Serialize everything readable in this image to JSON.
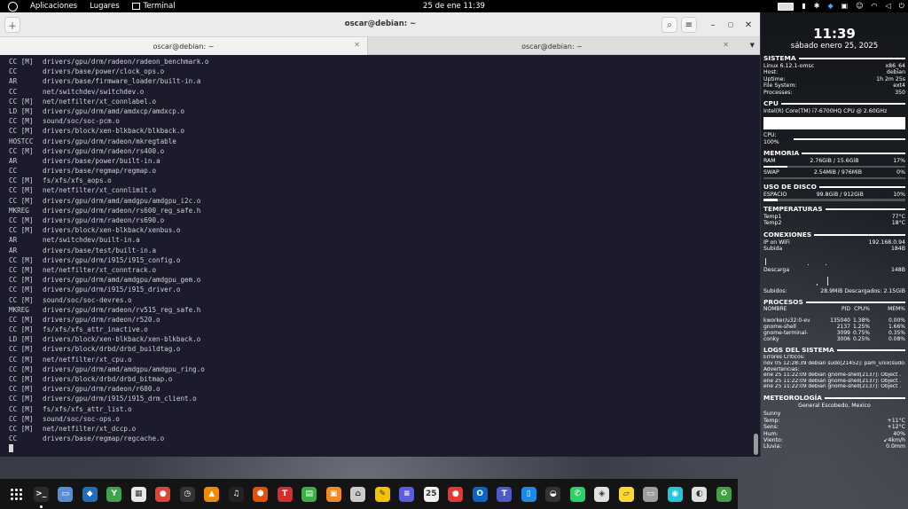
{
  "topbar": {
    "applications": "Aplicaciones",
    "places": "Lugares",
    "terminal_app": "Terminal",
    "clock": "25 de ene  11:39"
  },
  "window": {
    "title": "oscar@debian: ~",
    "tabs": [
      {
        "label": "oscar@debian: ~",
        "active": true
      },
      {
        "label": "oscar@debian: ~",
        "active": false
      }
    ]
  },
  "terminal": {
    "lines": [
      [
        "CC [M]",
        "drivers/gpu/drm/radeon/radeon_benchmark.o"
      ],
      [
        "CC",
        "drivers/base/power/clock_ops.o"
      ],
      [
        "AR",
        "drivers/base/firmware_loader/built-in.a"
      ],
      [
        "CC",
        "net/switchdev/switchdev.o"
      ],
      [
        "CC [M]",
        "net/netfilter/xt_connlabel.o"
      ],
      [
        "LD [M]",
        "drivers/gpu/drm/amd/amdxcp/amdxcp.o"
      ],
      [
        "CC [M]",
        "sound/soc/soc-pcm.o"
      ],
      [
        "CC [M]",
        "drivers/block/xen-blkback/blkback.o"
      ],
      [
        "HOSTCC",
        "drivers/gpu/drm/radeon/mkregtable"
      ],
      [
        "CC [M]",
        "drivers/gpu/drm/radeon/rs400.o"
      ],
      [
        "AR",
        "drivers/base/power/built-in.a"
      ],
      [
        "CC",
        "drivers/base/regmap/regmap.o"
      ],
      [
        "CC [M]",
        "fs/xfs/xfs_aops.o"
      ],
      [
        "CC [M]",
        "net/netfilter/xt_connlimit.o"
      ],
      [
        "CC [M]",
        "drivers/gpu/drm/amd/amdgpu/amdgpu_i2c.o"
      ],
      [
        "MKREG",
        "drivers/gpu/drm/radeon/rs600_reg_safe.h"
      ],
      [
        "CC [M]",
        "drivers/gpu/drm/radeon/rs690.o"
      ],
      [
        "CC [M]",
        "drivers/block/xen-blkback/xenbus.o"
      ],
      [
        "AR",
        "net/switchdev/built-in.a"
      ],
      [
        "AR",
        "drivers/base/test/built-in.a"
      ],
      [
        "CC [M]",
        "drivers/gpu/drm/i915/i915_config.o"
      ],
      [
        "CC [M]",
        "net/netfilter/xt_conntrack.o"
      ],
      [
        "CC [M]",
        "drivers/gpu/drm/amd/amdgpu/amdgpu_gem.o"
      ],
      [
        "CC [M]",
        "drivers/gpu/drm/i915/i915_driver.o"
      ],
      [
        "CC [M]",
        "sound/soc/soc-devres.o"
      ],
      [
        "MKREG",
        "drivers/gpu/drm/radeon/rv515_reg_safe.h"
      ],
      [
        "CC [M]",
        "drivers/gpu/drm/radeon/r520.o"
      ],
      [
        "CC [M]",
        "fs/xfs/xfs_attr_inactive.o"
      ],
      [
        "LD [M]",
        "drivers/block/xen-blkback/xen-blkback.o"
      ],
      [
        "CC [M]",
        "drivers/block/drbd/drbd_buildtag.o"
      ],
      [
        "CC [M]",
        "net/netfilter/xt_cpu.o"
      ],
      [
        "CC [M]",
        "drivers/gpu/drm/amd/amdgpu/amdgpu_ring.o"
      ],
      [
        "CC [M]",
        "drivers/block/drbd/drbd_bitmap.o"
      ],
      [
        "CC [M]",
        "drivers/gpu/drm/radeon/r600.o"
      ],
      [
        "CC [M]",
        "drivers/gpu/drm/i915/i915_drm_client.o"
      ],
      [
        "CC [M]",
        "fs/xfs/xfs_attr_list.o"
      ],
      [
        "CC [M]",
        "sound/soc/soc-ops.o"
      ],
      [
        "CC [M]",
        "net/netfilter/xt_dccp.o"
      ],
      [
        "CC",
        "drivers/base/regmap/regcache.o"
      ]
    ]
  },
  "dock": {
    "apps": [
      {
        "name": "terminal",
        "color": "#2b2b2b",
        "glyph": ">_",
        "running": true
      },
      {
        "name": "files",
        "color": "#5b8dd6",
        "glyph": "▭",
        "running": false
      },
      {
        "name": "vscode",
        "color": "#1f6fbf",
        "glyph": "◆",
        "running": false
      },
      {
        "name": "system-monitor",
        "color": "#3fa34d",
        "glyph": "Y",
        "running": false
      },
      {
        "name": "calendar-app",
        "color": "#e8e8e8",
        "glyph": "▦",
        "running": false
      },
      {
        "name": "chrome",
        "color": "#db4437",
        "glyph": "●",
        "running": false
      },
      {
        "name": "clock-app",
        "color": "#333333",
        "glyph": "◷",
        "running": false
      },
      {
        "name": "vlc",
        "color": "#f08a00",
        "glyph": "▲",
        "running": false
      },
      {
        "name": "music",
        "color": "#222222",
        "glyph": "♫",
        "running": false
      },
      {
        "name": "colors-app",
        "color": "#e65100",
        "glyph": "⬢",
        "running": false
      },
      {
        "name": "red-app",
        "color": "#d32f2f",
        "glyph": "T",
        "running": false
      },
      {
        "name": "spreadsheet",
        "color": "#3fae49",
        "glyph": "▤",
        "running": false
      },
      {
        "name": "presentation",
        "color": "#f08a24",
        "glyph": "▣",
        "running": false
      },
      {
        "name": "shop",
        "color": "#cccccc",
        "glyph": "⌂",
        "running": false
      },
      {
        "name": "text-editor",
        "color": "#f2c200",
        "glyph": "✎",
        "running": false
      },
      {
        "name": "notes",
        "color": "#5c5ce0",
        "glyph": "≡",
        "running": false
      },
      {
        "name": "calendar",
        "color": "#f0f0f0",
        "glyph": "25",
        "running": false
      },
      {
        "name": "red-circle-app",
        "color": "#e53935",
        "glyph": "●",
        "running": false
      },
      {
        "name": "outlook",
        "color": "#0a64c8",
        "glyph": "O",
        "running": false
      },
      {
        "name": "teams",
        "color": "#5059c9",
        "glyph": "T",
        "running": false
      },
      {
        "name": "phone-app",
        "color": "#1e88e5",
        "glyph": "▯",
        "running": false
      },
      {
        "name": "glasses-app",
        "color": "#333333",
        "glyph": "◒",
        "running": false
      },
      {
        "name": "whatsapp",
        "color": "#25d366",
        "glyph": "✆",
        "running": false
      },
      {
        "name": "media-app",
        "color": "#e0e0e0",
        "glyph": "◈",
        "running": false
      },
      {
        "name": "sticky-notes",
        "color": "#fdd835",
        "glyph": "▱",
        "running": false
      },
      {
        "name": "drive-app",
        "color": "#9e9e9e",
        "glyph": "▭",
        "running": false
      },
      {
        "name": "messenger",
        "color": "#26c6da",
        "glyph": "◉",
        "running": false
      },
      {
        "name": "chat-app",
        "color": "#e0e0e0",
        "glyph": "◐",
        "running": false
      },
      {
        "name": "trash-app",
        "color": "#43a047",
        "glyph": "♻",
        "running": false
      }
    ]
  },
  "conky": {
    "time": "11:39",
    "date": "sábado enero 25, 2025",
    "system": {
      "title": "SISTEMA",
      "rows": [
        [
          "Linux 6.12.1-omsc",
          "x86_64"
        ],
        [
          "Host:",
          "debian"
        ],
        [
          "Uptime:",
          "1h 2m 25s"
        ],
        [
          "File System:",
          "ext4"
        ],
        [
          "Processes:",
          "350"
        ]
      ]
    },
    "cpu": {
      "title": "CPU",
      "model": "Intel(R) Core(TM) i7-6700HQ CPU @ 2.60GHz",
      "usage_label": "CPU: 100%",
      "usage": 1.0
    },
    "memory": {
      "title": "MEMORIA",
      "ram": {
        "label": "RAM",
        "value": "2.76GiB / 15.6GiB",
        "pct": "17%",
        "fill": 0.17
      },
      "swap": {
        "label": "SWAP",
        "value": "2.54MiB / 976MiB",
        "pct": "0%",
        "fill": 0.0
      }
    },
    "disk": {
      "title": "USO DE DISCO",
      "label": "ESPACIO",
      "value": "99.8GiB / 912GiB",
      "pct": "10%",
      "fill": 0.1
    },
    "temps": {
      "title": "TEMPERATURAS",
      "rows": [
        [
          "Temp1",
          "77°C"
        ],
        [
          "Temp2",
          "18°C"
        ]
      ]
    },
    "net": {
      "title": "CONEXIONES",
      "ip_label": "IP on WiFi",
      "ip": "192.168.0.94",
      "up_label": "Subida",
      "up": "184B",
      "down_label": "Descarga",
      "down": "148B",
      "totals_left": "Subidos:",
      "totals_right": "28.9MiB Descargados:  2.15GiB"
    },
    "procs": {
      "title": "PROCESOS",
      "header": [
        "NOMBRE",
        "PID",
        "CPU%",
        "MEM%"
      ],
      "rows": [
        [
          "kworker/u32:0-ev",
          "135040",
          "1.38%",
          "0.00%"
        ],
        [
          "gnome-shell",
          "2137",
          "1.25%",
          "1.66%"
        ],
        [
          "gnome-terminal-",
          "3099",
          "0.75%",
          "0.35%"
        ],
        [
          "conky",
          "3006",
          "0.25%",
          "0.08%"
        ]
      ]
    },
    "logs": {
      "title": "LOGS DEL SISTEMA",
      "lines": [
        "Errores Críticos:",
        "nov 05 12:28:39 debian sudo[21452]: pam_unix(sudo:",
        "Advertencias:",
        "ene 25 11:22:09 debian gnome-shell[2137]: Object .",
        "ene 25 11:22:09 debian gnome-shell[2137]: Object .",
        "ene 25 11:22:09 debian gnome-shell[2137]: Object ."
      ]
    },
    "weather": {
      "title": "METEOROLOGÍA",
      "location": "General Escobedo, Mexico",
      "condition": "Sunny",
      "rows": [
        [
          "Temp:",
          "+11°C"
        ],
        [
          "Sens:",
          "+12°C"
        ],
        [
          "Hum:",
          "40%"
        ],
        [
          "Viento:",
          "↙4km/h"
        ],
        [
          "Lluvia:",
          "0.0mm"
        ]
      ]
    }
  }
}
